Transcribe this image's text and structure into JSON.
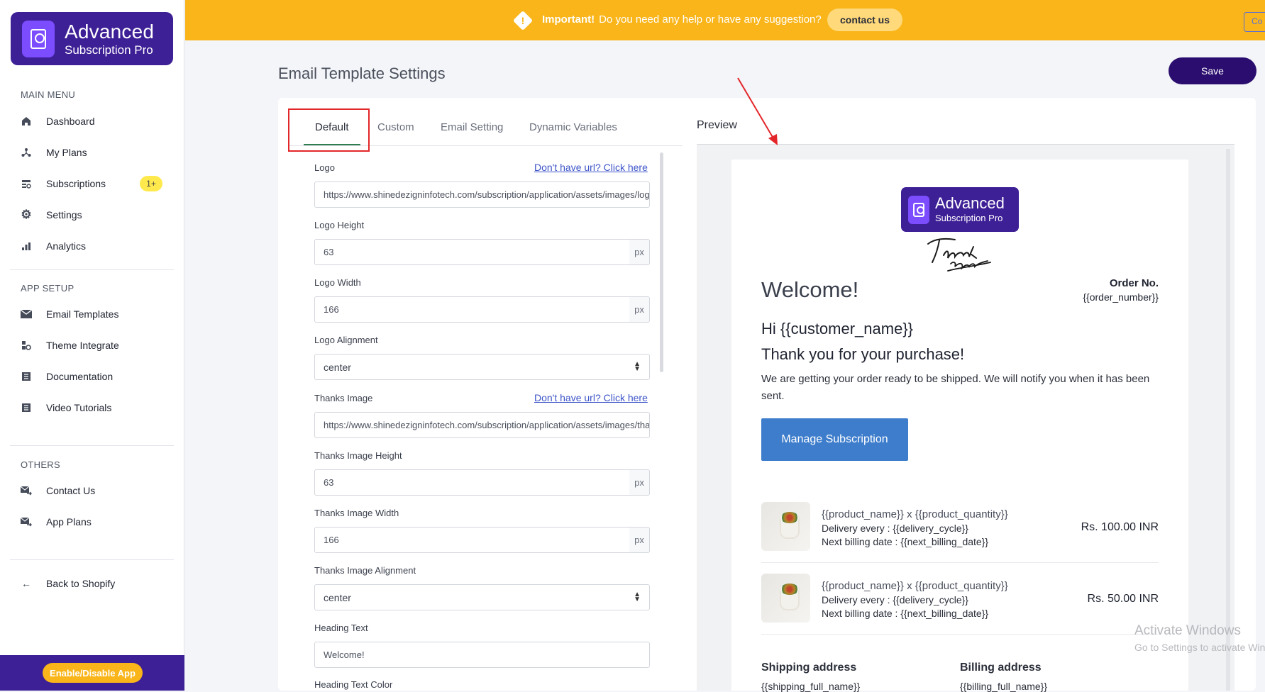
{
  "brand": {
    "line1": "Advanced",
    "line2": "Subscription Pro"
  },
  "sidebar": {
    "main_menu_label": "MAIN MENU",
    "main_items": [
      {
        "label": "Dashboard",
        "icon": "home-icon"
      },
      {
        "label": "My Plans",
        "icon": "plans-icon"
      },
      {
        "label": "Subscriptions",
        "icon": "subscriptions-icon",
        "badge": "1+"
      },
      {
        "label": "Settings",
        "icon": "gear-icon"
      },
      {
        "label": "Analytics",
        "icon": "bar-chart-icon"
      }
    ],
    "app_setup_label": "APP SETUP",
    "setup_items": [
      {
        "label": "Email Templates",
        "icon": "envelope-icon"
      },
      {
        "label": "Theme Integrate",
        "icon": "theme-icon"
      },
      {
        "label": "Documentation",
        "icon": "document-list-icon"
      },
      {
        "label": "Video Tutorials",
        "icon": "video-list-icon"
      }
    ],
    "others_label": "OTHERS",
    "other_items": [
      {
        "label": "Contact Us",
        "icon": "mail-send-icon"
      },
      {
        "label": "App Plans",
        "icon": "mail-send-icon"
      }
    ],
    "back_label": "Back to Shopify",
    "enable_button": "Enable/Disable App"
  },
  "topbar": {
    "important": "Important!",
    "message": "Do you need any help or have any suggestion?",
    "contact_button": "contact us",
    "right_cut": "Co"
  },
  "page": {
    "title": "Email Template Settings",
    "save_label": "Save"
  },
  "tabs": [
    "Default",
    "Custom",
    "Email Setting",
    "Dynamic Variables"
  ],
  "form": {
    "logo_label": "Logo",
    "logo_link": "Don't have url? Click here",
    "logo_url": "https://www.shinedezigninfotech.com/subscription/application/assets/images/logo",
    "logo_height_label": "Logo Height",
    "logo_height": "63",
    "logo_width_label": "Logo Width",
    "logo_width": "166",
    "logo_alignment_label": "Logo Alignment",
    "logo_alignment": "center",
    "thanks_image_label": "Thanks Image",
    "thanks_link": "Don't have url? Click here",
    "thanks_url": "https://www.shinedezigninfotech.com/subscription/application/assets/images/tha",
    "thanks_height_label": "Thanks Image Height",
    "thanks_height": "63",
    "thanks_width_label": "Thanks Image Width",
    "thanks_width": "166",
    "thanks_alignment_label": "Thanks Image Alignment",
    "thanks_alignment": "center",
    "heading_text_label": "Heading Text",
    "heading_text": "Welcome!",
    "heading_color_label": "Heading Text Color",
    "unit": "px"
  },
  "preview": {
    "label": "Preview",
    "logo_line1": "Advanced",
    "logo_line2": "Subscription Pro",
    "welcome": "Welcome!",
    "order_no_label": "Order No.",
    "order_number": "{{order_number}}",
    "greeting": "Hi {{customer_name}}",
    "thank_you": "Thank you for your purchase!",
    "body": "We are getting your order ready to be shipped. We will notify you when it has been sent.",
    "manage_button": "Manage Subscription",
    "products": [
      {
        "name": "{{product_name}} x {{product_quantity}}",
        "delivery": "Delivery every : {{delivery_cycle}}",
        "billing": "Next billing date : {{next_billing_date}}",
        "price": "Rs. 100.00 INR"
      },
      {
        "name": "{{product_name}} x {{product_quantity}}",
        "delivery": "Delivery every : {{delivery_cycle}}",
        "billing": "Next billing date : {{next_billing_date}}",
        "price": "Rs. 50.00 INR"
      }
    ],
    "shipping_title": "Shipping address",
    "shipping_value": "{{shipping_full_name}}",
    "billing_title": "Billing address",
    "billing_value": "{{billing_full_name}}"
  },
  "watermark": {
    "line1": "Activate Windows",
    "line2": "Go to Settings to activate Windows."
  },
  "colors": {
    "brand": "#3d1f96",
    "topbar": "#f9b51a",
    "save": "#2a0d6e",
    "manage_button": "#3d7dcc",
    "highlight": "#e3262a"
  }
}
